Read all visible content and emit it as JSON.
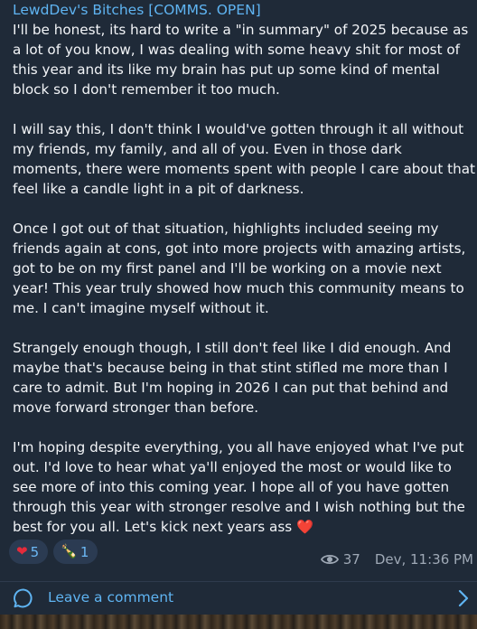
{
  "post": {
    "channel_name": "LewdDev's Bitches [COMMS. OPEN]",
    "paragraphs": [
      "I'll be honest, its hard to write a \"in summary\" of 2025 because as a lot of you know, I was dealing with some heavy shit for most of this year and its like my brain has put up some kind of mental block so I don't remember it too much.",
      "I will say this, I don't think I would've gotten through it all  without my friends, my family, and all of you. Even in those dark moments, there were moments spent with people I care about that feel like a candle light in a pit of darkness.",
      "Once I got out of that situation, highlights included seeing my friends again at cons, got into more projects with amazing artists, got to be on my first panel and I'll be working on a movie next year! This year truly showed how much this community means to me. I can't imagine myself without it.",
      "Strangely enough though, I still don't feel like I did enough. And maybe that's because being in that stint stifled me more than I care to admit. But I'm hoping in 2026 I can put that behind and move forward stronger than before.",
      "I'm hoping despite everything, you all have enjoyed what I've put out. I'd love to hear what ya'll enjoyed the most or would like to see more of into this coming year. I hope all of you have gotten through this year with stronger resolve and I wish nothing but the best for you all. Let's kick next years ass"
    ],
    "end_emoji": "❤️",
    "reactions": [
      {
        "emoji": "❤",
        "icon": "heart-icon",
        "count": "5"
      },
      {
        "emoji": "🍾",
        "icon": "champagne-icon",
        "count": "1"
      }
    ],
    "views": "37",
    "timestamp": "Dev, 11:36 PM"
  },
  "comments": {
    "label": "Leave a comment"
  },
  "colors": {
    "background": "#1f2a38",
    "accent": "#5fb4f2",
    "text": "#f3f5f8",
    "meta": "#9fa9b6"
  }
}
